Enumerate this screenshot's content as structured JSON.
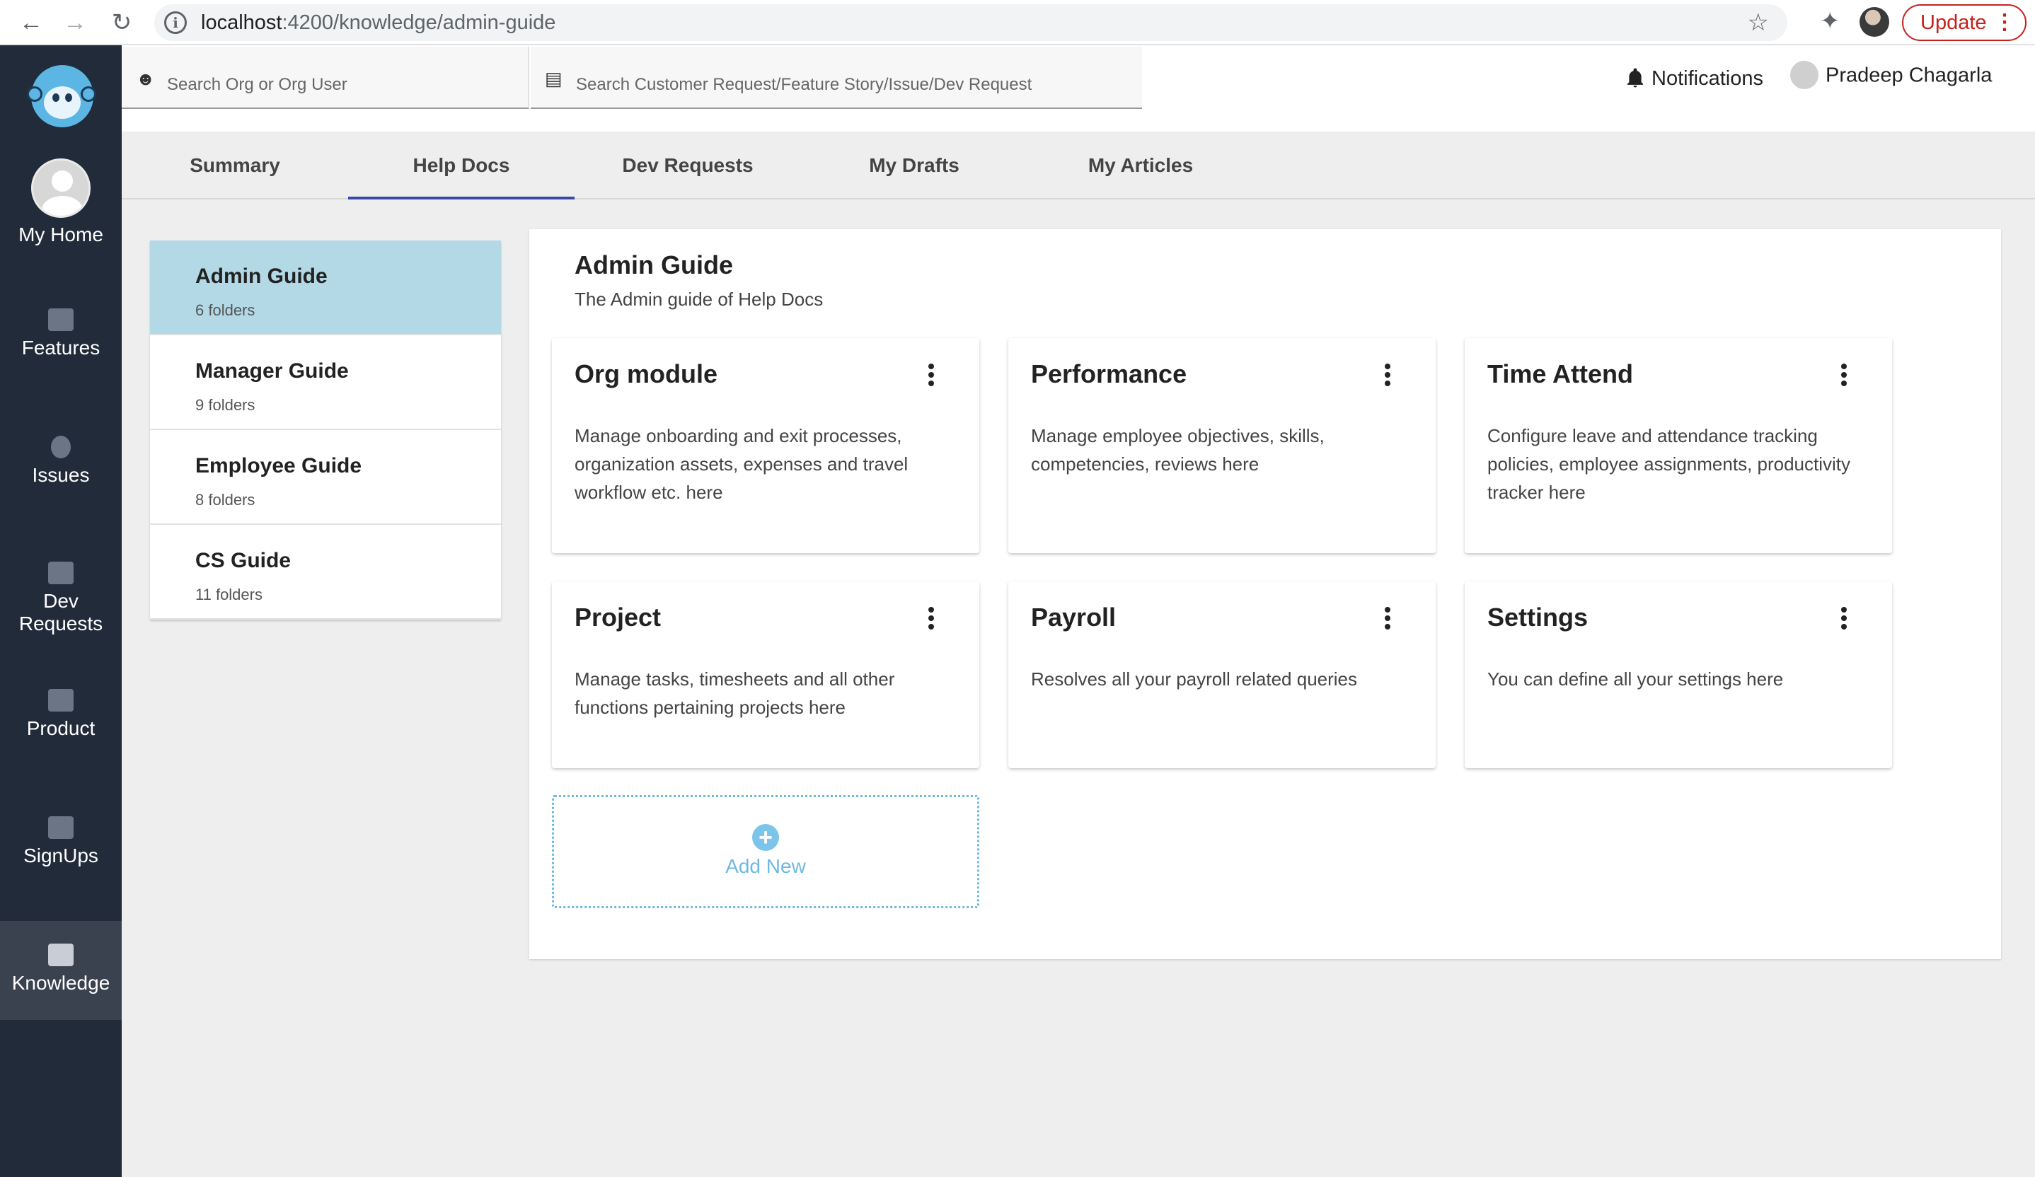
{
  "browser": {
    "url_host": "localhost",
    "url_path": ":4200/knowledge/admin-guide",
    "update_label": "Update"
  },
  "sidebar": {
    "items": [
      {
        "label": "My Home",
        "icon": "user-avatar"
      },
      {
        "label": "Features",
        "icon": "clipboard-icon"
      },
      {
        "label": "Issues",
        "icon": "bug-icon"
      },
      {
        "label": "Dev Requests",
        "icon": "flag-icon"
      },
      {
        "label": "Product",
        "icon": "building-icon"
      },
      {
        "label": "SignUps",
        "icon": "id-card-icon"
      },
      {
        "label": "Knowledge",
        "icon": "graduation-cap-icon"
      }
    ],
    "active": "Knowledge"
  },
  "header": {
    "search_org_placeholder": "Search Org or Org User",
    "search_request_placeholder": "Search Customer Request/Feature Story/Issue/Dev Request",
    "notifications_label": "Notifications",
    "user_name": "Pradeep Chagarla"
  },
  "tabs": [
    {
      "label": "Summary",
      "active": false
    },
    {
      "label": "Help Docs",
      "active": true
    },
    {
      "label": "Dev Requests",
      "active": false
    },
    {
      "label": "My Drafts",
      "active": false
    },
    {
      "label": "My Articles",
      "active": false
    }
  ],
  "guides": [
    {
      "name": "Admin Guide",
      "count": "6 folders",
      "active": true
    },
    {
      "name": "Manager Guide",
      "count": "9 folders",
      "active": false
    },
    {
      "name": "Employee Guide",
      "count": "8 folders",
      "active": false
    },
    {
      "name": "CS Guide",
      "count": "11 folders",
      "active": false
    }
  ],
  "main": {
    "title": "Admin Guide",
    "subtitle": "The Admin guide of Help Docs",
    "cards": [
      {
        "title": "Org module",
        "description": "Manage onboarding and exit processes, organization assets, expenses and travel workflow etc. here"
      },
      {
        "title": "Performance",
        "description": "Manage employee objectives, skills, competencies, reviews here"
      },
      {
        "title": "Time Attend",
        "description": "Configure leave and attendance tracking policies, employee assignments, productivity tracker here"
      },
      {
        "title": "Project",
        "description": "Manage tasks, timesheets and all other functions pertaining projects here"
      },
      {
        "title": "Payroll",
        "description": "Resolves all your payroll related queries"
      },
      {
        "title": "Settings",
        "description": "You can define all your settings here"
      }
    ],
    "add_new_label": "Add New"
  },
  "colors": {
    "sidebar_bg": "#222b3a",
    "active_guide_bg": "#b3d9e7",
    "tab_underline": "#3949ab",
    "add_new_accent": "#6fb8e0"
  }
}
